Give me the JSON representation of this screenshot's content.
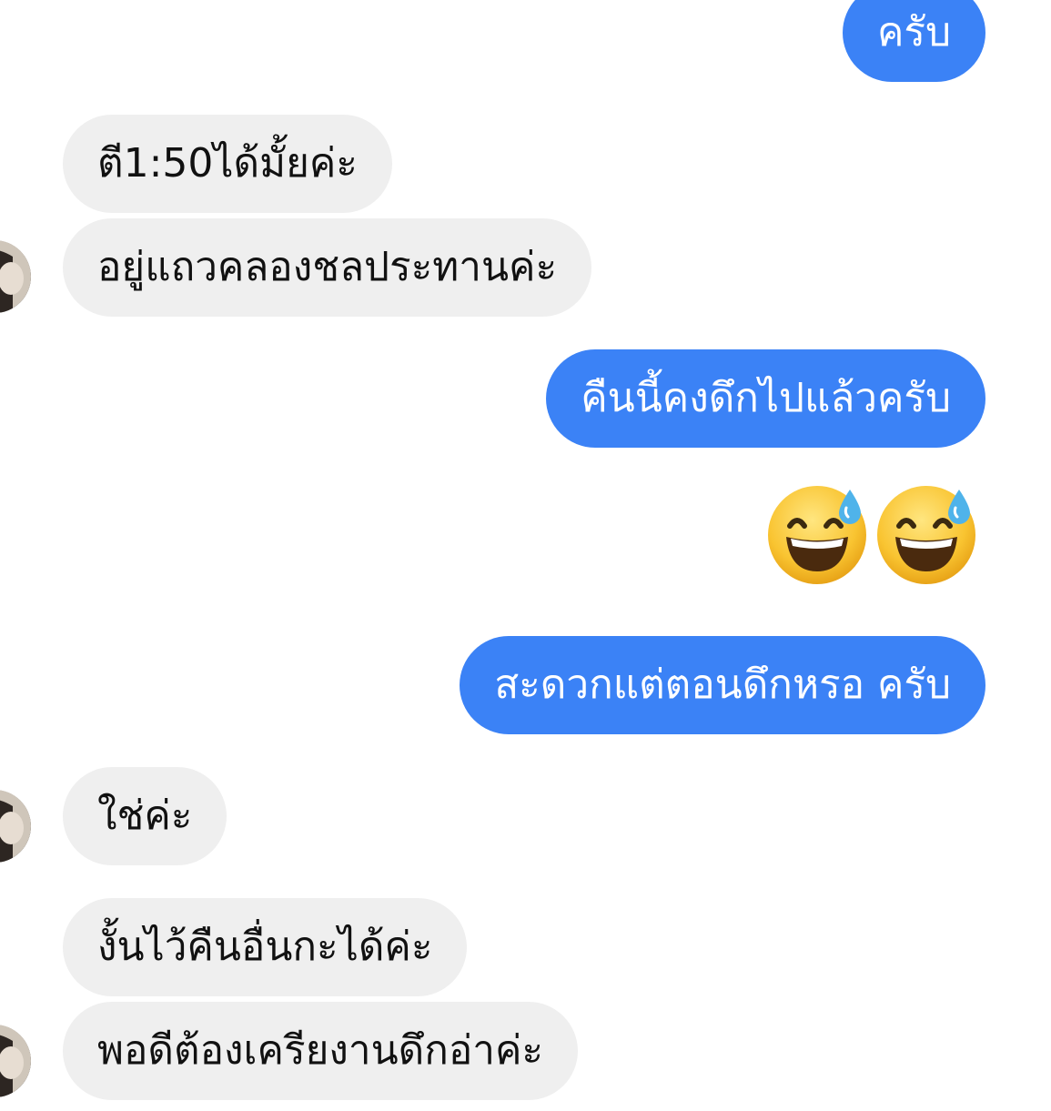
{
  "messages": [
    {
      "from": "me",
      "text": "ครับ"
    },
    {
      "from": "them",
      "text": "ตี1:50ได้มั้ยค่ะ"
    },
    {
      "from": "them",
      "text": "อยู่แถวคลองชลประทานค่ะ"
    },
    {
      "from": "me",
      "text": "คืนนี้คงดึกไปแล้วครับ"
    },
    {
      "from": "me",
      "text": "😅😅",
      "emoji": "sweat-smile-icon"
    },
    {
      "from": "me",
      "text": "สะดวกแต่ตอนดึกหรอ ครับ"
    },
    {
      "from": "them",
      "text": "ใช่ค่ะ"
    },
    {
      "from": "them",
      "text": "งั้นไว้คืนอื่นกะได้ค่ะ"
    },
    {
      "from": "them",
      "text": "พอดีต้องเครียงานดึกอ่าค่ะ"
    }
  ],
  "colors": {
    "outgoing_bubble": "#3b82f6",
    "incoming_bubble": "#efefef"
  }
}
